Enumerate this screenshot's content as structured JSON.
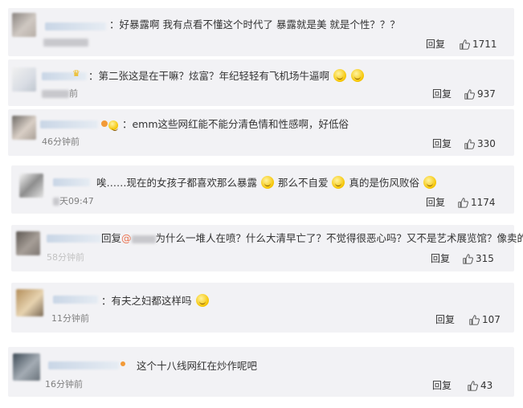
{
  "comments": [
    {
      "text": "：好暴露啊 我有点看不懂这个时代了 暴露就是美 就是个性？？？",
      "time": "",
      "reply": "回复",
      "likes": "1711"
    },
    {
      "text": "：第二张这是在干嘛？炫富？年纪轻轻有飞机场牛逼啊",
      "time": "前",
      "reply": "回复",
      "likes": "937"
    },
    {
      "text": "：emm这些网红能不能分清色情和性感啊，好低俗",
      "time": "46分钟前",
      "reply": "回复",
      "likes": "330"
    },
    {
      "text_a": "唉……现在的女孩子都喜欢那么暴露",
      "text_b": "那么不自爱",
      "text_c": "真的是伤风败俗",
      "time": "天09:47",
      "reply": "回复",
      "likes": "1174"
    },
    {
      "reply_prefix": "回复",
      "text": "为什么一堆人在喷？什么大清早亡了？不觉得很恶心吗？又不是艺术展览馆？像卖的",
      "time": "58分钟前",
      "reply": "回复",
      "likes": "315"
    },
    {
      "text": "：有夫之妇都这样吗",
      "time": "11分钟前",
      "reply": "回复",
      "likes": "107"
    },
    {
      "text": "这个十八线网红在炒作呢吧",
      "time": "16分钟前",
      "reply": "回复",
      "likes": "43"
    }
  ],
  "icons": {
    "like": "thumbs-up-icon",
    "emoji": "smiley-emoji-icon"
  },
  "colors": {
    "card_bg": "#f2f2f5",
    "link": "#eb7350",
    "muted": "#808080"
  }
}
